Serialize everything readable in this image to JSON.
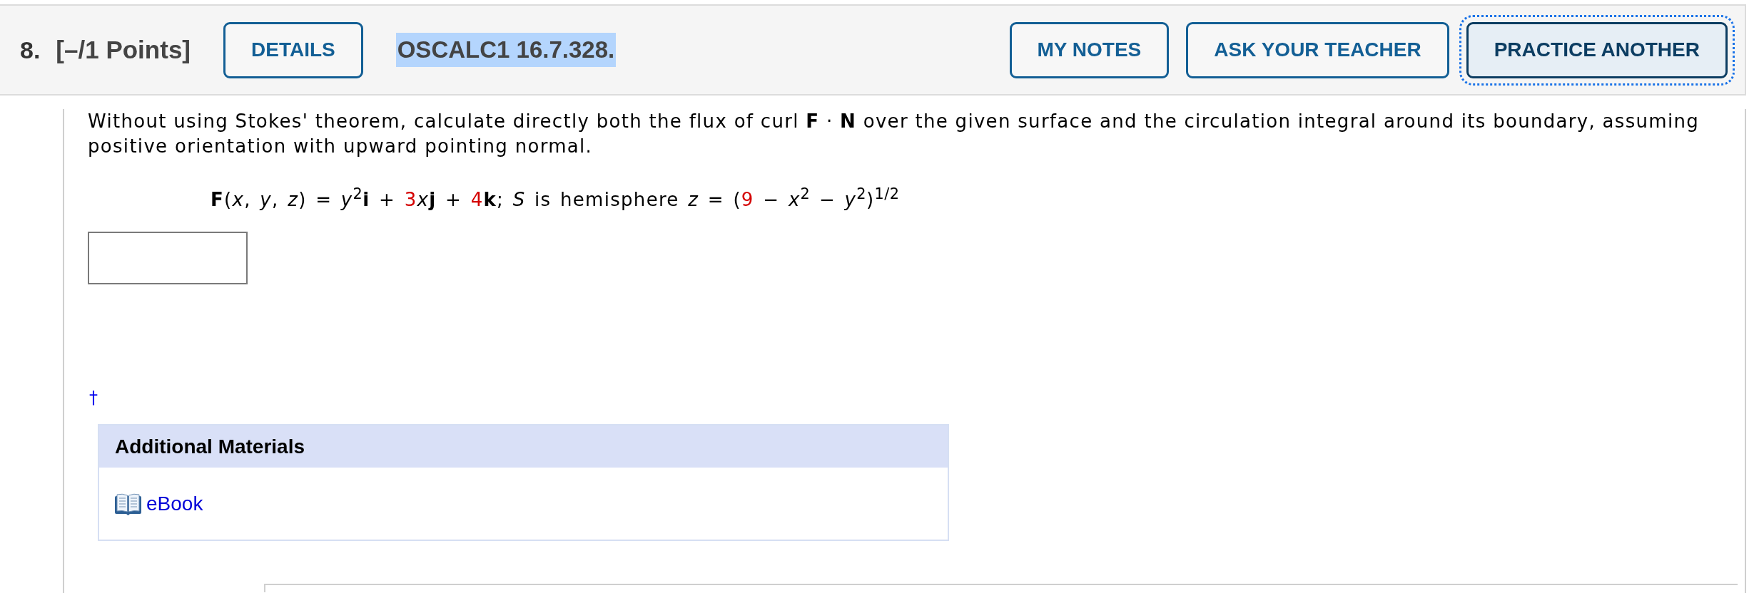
{
  "question": {
    "number": "8.",
    "points": "[–/1 Points]",
    "code": "OSCALC1 16.7.328.",
    "code_highlighted": true
  },
  "details_button": {
    "label": "DETAILS",
    "focused": false
  },
  "actions": [
    {
      "label": "MY NOTES",
      "focused": false
    },
    {
      "label": "ASK YOUR TEACHER",
      "focused": false
    },
    {
      "label": "PRACTICE ANOTHER",
      "focused": true
    }
  ],
  "problem": {
    "text": "Without using Stokes' theorem, calculate directly both the flux of curl **F** · **N** over the given surface and the circulation integral around its boundary, assuming positive orientation with upward pointing normal.",
    "formula": [
      {
        "kind": "plain",
        "text": "**F**(*x*, *y*, *z*) = *y*$^{2}$**i** + "
      },
      {
        "kind": "value",
        "text": "3"
      },
      {
        "kind": "plain",
        "text": "*x*"
      },
      {
        "kind": "plain",
        "text": "**j** + "
      },
      {
        "kind": "value",
        "text": "4"
      },
      {
        "kind": "plain",
        "text": "**k**; *S* is hemisphere *z* = ("
      },
      {
        "kind": "value",
        "text": "9"
      },
      {
        "kind": "plain",
        "text": " − *x*$^{2}$ − *y*$^{2}$)$^{1/2}$"
      }
    ],
    "footnote": "†"
  },
  "additional_materials": {
    "title": "Additional Materials",
    "links": [
      {
        "kind": "book",
        "label": "eBook"
      }
    ]
  }
}
